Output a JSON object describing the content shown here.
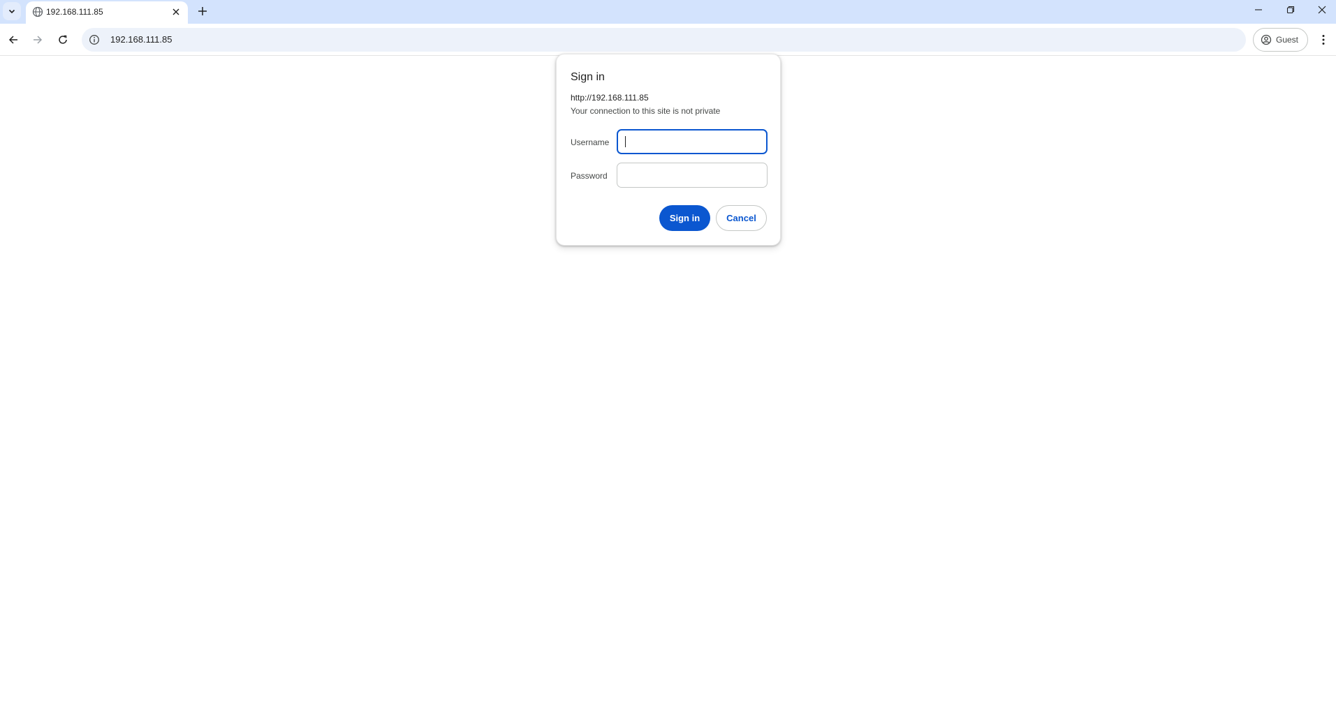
{
  "tab": {
    "title": "192.168.111.85",
    "favicon": "globe-icon"
  },
  "toolbar": {
    "url": "192.168.111.85",
    "profile_label": "Guest"
  },
  "dialog": {
    "title": "Sign in",
    "origin": "http://192.168.111.85",
    "note": "Your connection to this site is not private",
    "username_label": "Username",
    "username_value": "",
    "password_label": "Password",
    "password_value": "",
    "signin_label": "Sign in",
    "cancel_label": "Cancel"
  },
  "colors": {
    "tabstrip": "#d3e3fd",
    "omnibox": "#edf2fa",
    "accent": "#0b57d0"
  }
}
